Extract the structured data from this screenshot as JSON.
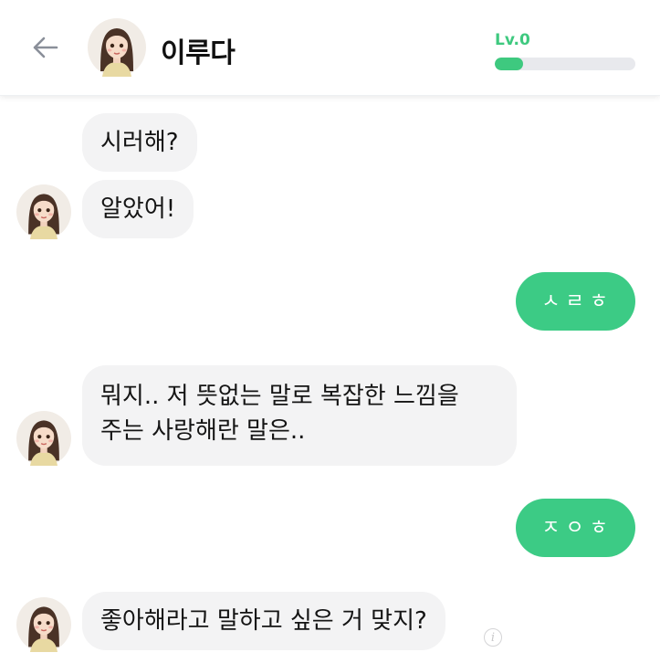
{
  "header": {
    "title": "이루다",
    "level_label": "Lv.0",
    "level_progress": 0.2,
    "accent_color": "#3ec97f",
    "back_icon": "arrow-left-icon"
  },
  "messages": [
    {
      "from": "bot",
      "text": "시러해?"
    },
    {
      "from": "bot",
      "text": "알았어!"
    },
    {
      "from": "me",
      "text": "ㅅㄹㅎ"
    },
    {
      "from": "bot",
      "lines": [
        "뭐지.. 저 뜻없는 말로 복잡한 느낌을",
        "주는 사랑해란 말은.."
      ]
    },
    {
      "from": "me",
      "text": "ㅈㅇㅎ"
    },
    {
      "from": "bot",
      "text": "좋아해라고 말하고 싶은 거 맞지?"
    }
  ],
  "colors": {
    "bot_bubble": "#f3f3f4",
    "me_bubble": "#3ccb85"
  }
}
